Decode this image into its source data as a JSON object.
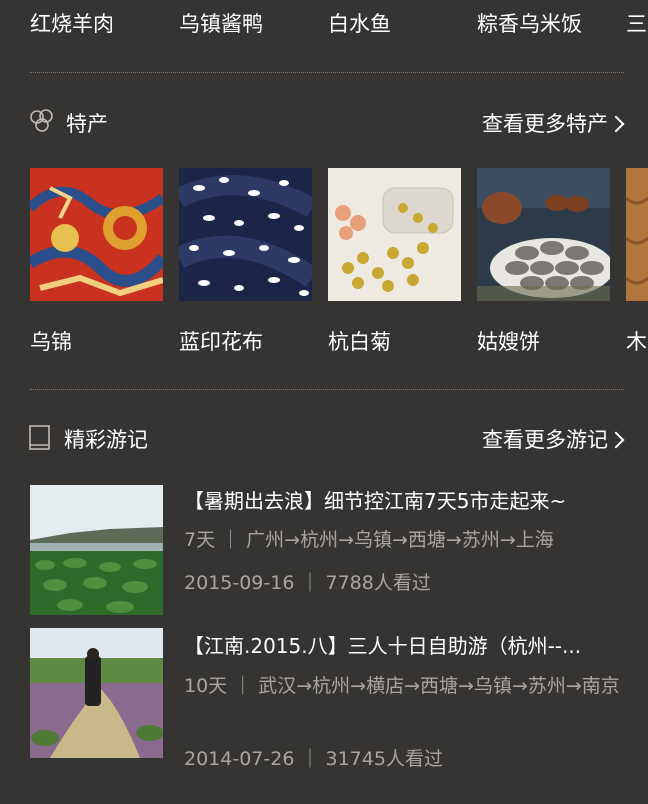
{
  "food_row": {
    "items": [
      "红烧羊肉",
      "乌镇酱鸭",
      "白水鱼",
      "粽香乌米饭",
      "三"
    ]
  },
  "specialties": {
    "title": "特产",
    "more_label": "查看更多特产",
    "icon": "cluster-icon",
    "items": [
      {
        "label": "乌锦"
      },
      {
        "label": "蓝印花布"
      },
      {
        "label": "杭白菊"
      },
      {
        "label": "姑嫂饼"
      },
      {
        "label": "木"
      }
    ]
  },
  "travelogues": {
    "title": "精彩游记",
    "more_label": "查看更多游记",
    "icon": "book-icon",
    "items": [
      {
        "title": "【暑期出去浪】细节控江南7天5市走起来~",
        "route": "7天 ｜ 广州→杭州→乌镇→西塘→苏州→上海",
        "meta": "2015-09-16 ｜ 7788人看过"
      },
      {
        "title": "【江南.2015.八】三人十日自助游（杭州--...",
        "route": "10天 ｜ 武汉→杭州→横店→西塘→乌镇→苏州→南京",
        "meta": "2014-07-26 ｜ 31745人看过"
      }
    ]
  },
  "colors": {
    "background": "#363432",
    "text": "#ffffff",
    "muted_text": "#a8a5a1",
    "divider": "#77736f"
  }
}
